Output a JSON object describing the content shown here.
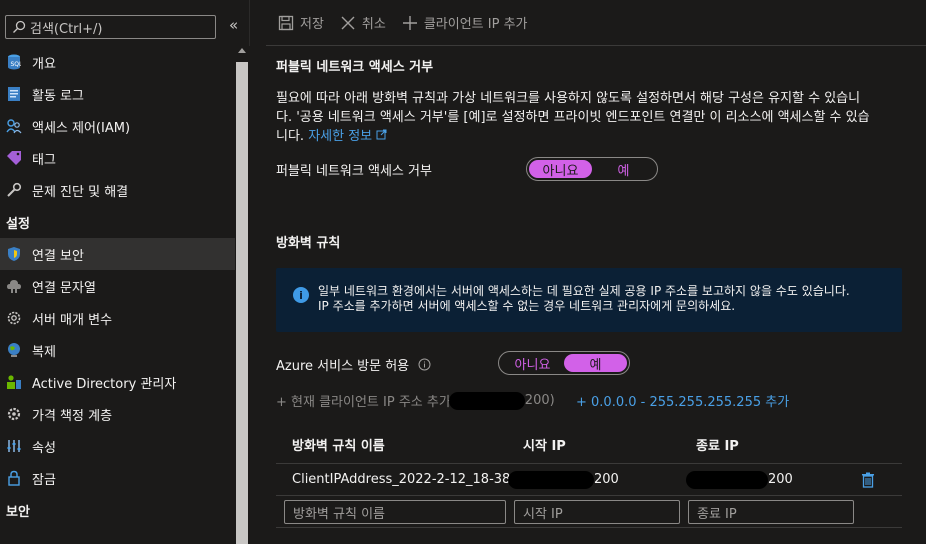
{
  "sidebar": {
    "search_placeholder": "검색(Ctrl+/)",
    "collapse_glyph": "«",
    "items_top": [
      {
        "label": "개요",
        "icon": "sql-overview-icon"
      },
      {
        "label": "활동 로그",
        "icon": "activity-log-icon"
      },
      {
        "label": "액세스 제어(IAM)",
        "icon": "iam-icon"
      },
      {
        "label": "태그",
        "icon": "tag-icon"
      },
      {
        "label": "문제 진단 및 해결",
        "icon": "wrench-icon"
      }
    ],
    "section_settings": "설정",
    "items_settings": [
      {
        "label": "연결 보안",
        "icon": "shield-icon",
        "active": true
      },
      {
        "label": "연결 문자열",
        "icon": "connection-strings-icon"
      },
      {
        "label": "서버 매개 변수",
        "icon": "gear-icon"
      },
      {
        "label": "복제",
        "icon": "globe-icon"
      },
      {
        "label": "Active Directory 관리자",
        "icon": "ad-admin-icon"
      },
      {
        "label": "가격 책정 계층",
        "icon": "pricing-tier-icon"
      },
      {
        "label": "속성",
        "icon": "properties-icon"
      },
      {
        "label": "잠금",
        "icon": "lock-icon"
      }
    ],
    "section_security": "보안"
  },
  "toolbar": {
    "save_label": "저장",
    "cancel_label": "취소",
    "add_client_ip_label": "클라이언트 IP 추가"
  },
  "main": {
    "public_access_title": "퍼블릭 네트워크 액세스 거부",
    "public_access_desc_1": "필요에 따라 아래 방화벽 규칙과 가상 네트워크를 사용하지 않도록 설정하면서 해당 구성은 유지할 수 있습니",
    "public_access_desc_2": "다. '공용 네트워크 액세스 거부'를 [예]로 설정하면 프라이빗 엔드포인트 연결만 이 리소스에 액세스할 수 있습",
    "public_access_desc_3": "니다.",
    "learn_more": "자세한 정보",
    "public_access_label": "퍼블릭 네트워크 액세스 거부",
    "toggle_no": "아니요",
    "toggle_yes": "예",
    "public_access_value": "아니요",
    "firewall_title": "방화벽 규칙",
    "info_line_1": "일부 네트워크 환경에서는 서버에 액세스하는 데 필요한 실제 공용 IP 주소를 보고하지 않을 수도 있습니다.",
    "info_line_2": "IP 주소를 추가하면 서버에 액세스할 수 없는 경우 네트워크 관리자에게 문의하세요.",
    "azure_services_label": "Azure 서비스 방문 허용",
    "azure_services_value": "예",
    "add_current_ip_prefix": "+ 현재 클라이언트 IP 주소 추가",
    "add_current_ip_suffix": "200)",
    "add_range": "+ 0.0.0.0 - 255.255.255.255 추가",
    "table": {
      "col_name": "방화벽 규칙 이름",
      "col_start": "시작 IP",
      "col_end": "종료 IP",
      "rows": [
        {
          "name": "ClientIPAddress_2022-2-12_18-38-8",
          "start_suffix": "200",
          "end_suffix": "200"
        }
      ],
      "placeholder_name": "방화벽 규칙 이름",
      "placeholder_start": "시작 IP",
      "placeholder_end": "종료 IP"
    }
  },
  "colors": {
    "toggle_accent": "#d261e8",
    "link": "#4aa0e6",
    "info_bg": "#0b2035"
  }
}
